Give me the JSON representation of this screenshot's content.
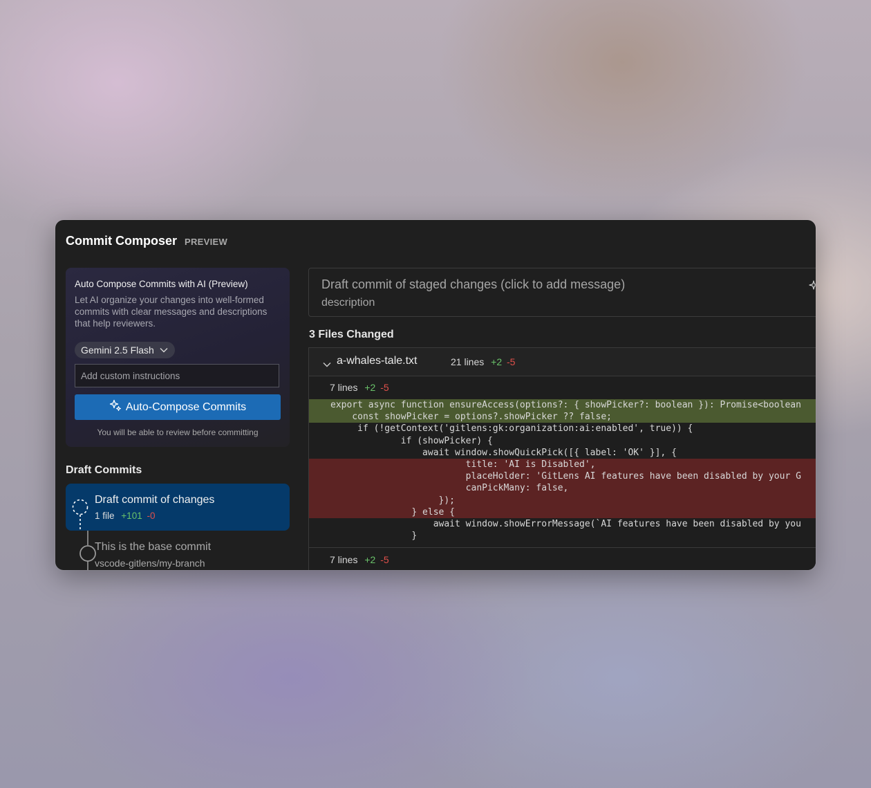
{
  "app": {
    "title": "Commit Composer",
    "preview_tag": "PREVIEW"
  },
  "ai_compose": {
    "title": "Auto Compose Commits with AI (Preview)",
    "description": "Let AI organize your changes into well-formed commits with clear messages and descriptions that help reviewers.",
    "model": "Gemini 2.5 Flash",
    "instructions_placeholder": "Add custom instructions",
    "button_label": "Auto-Compose Commits",
    "review_note": "You will be able to review before committing"
  },
  "draft_commits": {
    "heading": "Draft Commits",
    "commits": [
      {
        "title": "Draft commit of changes",
        "files": "1 file",
        "additions": "+101",
        "deletions": "-0"
      }
    ],
    "base": {
      "title": "This is the base commit",
      "branch": "vscode-gitlens/my-branch"
    }
  },
  "commit_message": {
    "title_placeholder": "Draft commit of staged changes (click to add message)",
    "description_placeholder": "description"
  },
  "files_changed": {
    "heading": "3 Files Changed",
    "file": {
      "name": "a-whales-tale.txt",
      "lines": "21 lines",
      "additions": "+2",
      "deletions": "-5"
    },
    "hunks": [
      {
        "lines": "7 lines",
        "additions": "+2",
        "deletions": "-5"
      },
      {
        "lines": "7 lines",
        "additions": "+2",
        "deletions": "-5"
      }
    ],
    "code_lines": [
      {
        "type": "added",
        "text": "export async function ensureAccess(options?: { showPicker?: boolean }): Promise<boolean"
      },
      {
        "type": "added",
        "text": "    const showPicker = options?.showPicker ?? false;"
      },
      {
        "type": "context",
        "text": "     if (!getContext('gitlens:gk:organization:ai:enabled', true)) {"
      },
      {
        "type": "context",
        "text": "             if (showPicker) {"
      },
      {
        "type": "context",
        "text": "                 await window.showQuickPick([{ label: 'OK' }], {"
      },
      {
        "type": "removed",
        "text": "                         title: 'AI is Disabled',"
      },
      {
        "type": "removed",
        "text": "                         placeHolder: 'GitLens AI features have been disabled by your G"
      },
      {
        "type": "removed",
        "text": "                         canPickMany: false,"
      },
      {
        "type": "removed",
        "text": "                    });"
      },
      {
        "type": "removed",
        "text": "               } else {"
      },
      {
        "type": "context",
        "text": "                   await window.showErrorMessage(`AI features have been disabled by you"
      },
      {
        "type": "context",
        "text": "               }"
      }
    ]
  },
  "colors": {
    "accent": "#1c6bb5",
    "selected_commit": "#053a6a",
    "added": "#6ac26a",
    "removed": "#e0504b",
    "added_line_bg": "#4b5a30",
    "removed_line_bg": "#5c2323"
  },
  "icons": {
    "model_dropdown": "chevron-down-icon",
    "compose": "sparkle-icon",
    "draft_commit": "dashed-circle-icon",
    "base_commit": "commit-node-icon",
    "file_toggle": "chevron-down-icon"
  }
}
